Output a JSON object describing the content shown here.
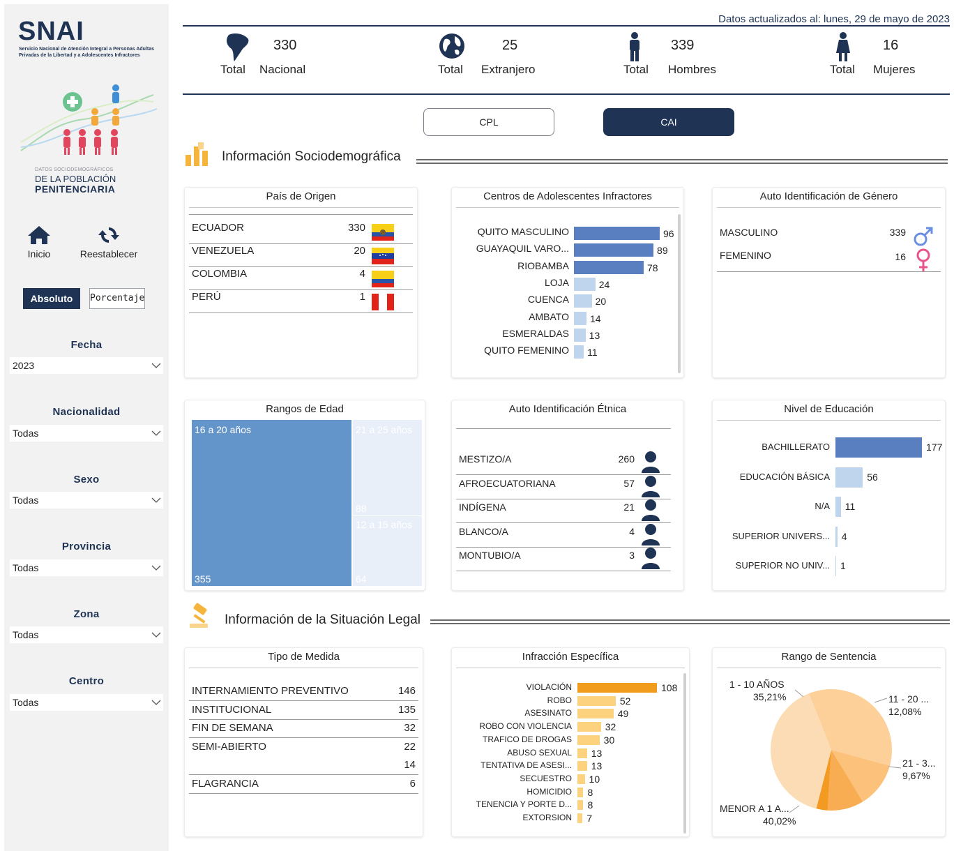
{
  "header": {
    "updated": "Datos actualizados al: lunes, 29 de mayo de 2023"
  },
  "sidebar": {
    "logo": "SNAI",
    "logo_subtitle": "Servicio Nacional de Atención Integral a Personas Adultas Privadas de la Libertad y a Adolescentes Infractores",
    "caption_small": "DATOS SOCIODEMOGRÁFICOS",
    "caption_mid": "DE LA POBLACIÓN",
    "caption_big": "PENITENCIARIA",
    "inicio": "Inicio",
    "reset": "Reestablecer",
    "absoluto": "Absoluto",
    "porcentaje": "Porcentaje",
    "filters": [
      {
        "title": "Fecha",
        "value": "2023"
      },
      {
        "title": "Nacionalidad",
        "value": "Todas"
      },
      {
        "title": "Sexo",
        "value": "Todas"
      },
      {
        "title": "Provincia",
        "value": "Todas"
      },
      {
        "title": "Zona",
        "value": "Todas"
      },
      {
        "title": "Centro",
        "value": "Todas"
      }
    ]
  },
  "kpis": [
    {
      "value": "330",
      "label1": "Total",
      "label2": "Nacional",
      "icon": "south-america-icon"
    },
    {
      "value": "25",
      "label1": "Total",
      "label2": "Extranjero",
      "icon": "globe-icon"
    },
    {
      "value": "339",
      "label1": "Total",
      "label2": "Hombres",
      "icon": "male-icon"
    },
    {
      "value": "16",
      "label1": "Total",
      "label2": "Mujeres",
      "icon": "female-icon"
    }
  ],
  "tabs": {
    "cpl": "CPL",
    "cai": "CAI"
  },
  "sections": {
    "socio": "Información Sociodemográfica",
    "legal": "Información de la Situación Legal"
  },
  "pais": {
    "title": "País de Origen",
    "rows": [
      {
        "name": "ECUADOR",
        "value": "330",
        "flag": "ecuador"
      },
      {
        "name": "VENEZUELA",
        "value": "20",
        "flag": "venezuela"
      },
      {
        "name": "COLOMBIA",
        "value": "4",
        "flag": "colombia"
      },
      {
        "name": "PERÚ",
        "value": "1",
        "flag": "peru"
      }
    ]
  },
  "centros": {
    "title": "Centros de Adolescentes Infractores",
    "rows": [
      {
        "name": "QUITO MASCULINO",
        "value": 96
      },
      {
        "name": "GUAYAQUIL VARO...",
        "value": 89
      },
      {
        "name": "RIOBAMBA",
        "value": 78
      },
      {
        "name": "LOJA",
        "value": 24
      },
      {
        "name": "CUENCA",
        "value": 20
      },
      {
        "name": "AMBATO",
        "value": 14
      },
      {
        "name": "ESMERALDAS",
        "value": 13
      },
      {
        "name": "QUITO FEMENINO",
        "value": 11
      }
    ]
  },
  "genero": {
    "title": "Auto Identificación de Género",
    "rows": [
      {
        "name": "MASCULINO",
        "value": "339"
      },
      {
        "name": "FEMENINO",
        "value": "16"
      }
    ]
  },
  "edad": {
    "title": "Rangos de Edad",
    "blocks": [
      {
        "label": "16 a 20 años",
        "value": "355"
      },
      {
        "label": "21 a 25 años",
        "value": "88"
      },
      {
        "label": "12 a 15 años",
        "value": "64"
      }
    ]
  },
  "etnia": {
    "title": "Auto Identificación Étnica",
    "rows": [
      {
        "name": "MESTIZO/A",
        "value": "260"
      },
      {
        "name": "AFROECUATORIANA",
        "value": "57"
      },
      {
        "name": "INDÍGENA",
        "value": "21"
      },
      {
        "name": "BLANCO/A",
        "value": "4"
      },
      {
        "name": "MONTUBIO/A",
        "value": "3"
      }
    ]
  },
  "educacion": {
    "title": "Nivel de Educación",
    "rows": [
      {
        "name": "BACHILLERATO",
        "value": 177
      },
      {
        "name": "EDUCACIÓN BÁSICA",
        "value": 56
      },
      {
        "name": "N/A",
        "value": 11
      },
      {
        "name": "SUPERIOR UNIVERS...",
        "value": 4
      },
      {
        "name": "SUPERIOR NO UNIV...",
        "value": 1
      }
    ]
  },
  "medida": {
    "title": "Tipo de Medida",
    "rows": [
      {
        "name": "INTERNAMIENTO PREVENTIVO",
        "value": "146"
      },
      {
        "name": "INSTITUCIONAL",
        "value": "135"
      },
      {
        "name": "FIN DE SEMANA",
        "value": "32"
      },
      {
        "name": "SEMI-ABIERTO",
        "value": "22"
      },
      {
        "name": "",
        "value": "14"
      },
      {
        "name": "FLAGRANCIA",
        "value": "6"
      }
    ]
  },
  "infraccion": {
    "title": "Infracción Específica",
    "rows": [
      {
        "name": "VIOLACIÓN",
        "value": 108
      },
      {
        "name": "ROBO",
        "value": 52
      },
      {
        "name": "ASESINATO",
        "value": 49
      },
      {
        "name": "ROBO CON VIOLENCIA",
        "value": 32
      },
      {
        "name": "TRAFICO DE DROGAS",
        "value": 30
      },
      {
        "name": "ABUSO SEXUAL",
        "value": 13
      },
      {
        "name": "TENTATIVA DE ASESI...",
        "value": 13
      },
      {
        "name": "SECUESTRO",
        "value": 10
      },
      {
        "name": "HOMICIDIO",
        "value": 8
      },
      {
        "name": "TENENCIA Y PORTE D...",
        "value": 8
      },
      {
        "name": "EXTORSION",
        "value": 7
      }
    ]
  },
  "sentencia": {
    "title": "Rango de Sentencia",
    "slices": [
      {
        "name": "MENOR A 1 A...",
        "pct": "40,02%",
        "value": 40.02,
        "color": "#fcdcb4"
      },
      {
        "name": "1 - 10 AÑOS",
        "pct": "35,21%",
        "value": 35.21,
        "color": "#fdd09a"
      },
      {
        "name": "11 - 20 ...",
        "pct": "12,08%",
        "value": 12.08,
        "color": "#fcc27b"
      },
      {
        "name": "21 - 3...",
        "pct": "9,67%",
        "value": 9.67,
        "color": "#f9ad52"
      },
      {
        "name": "",
        "pct": "",
        "value": 3.02,
        "color": "#f39a23"
      }
    ]
  },
  "colors": {
    "navy": "#1f3354",
    "bar_dark": "#5a7fc1",
    "bar_light": "#bfd5ee",
    "orange_dark": "#f29c1e",
    "orange_light": "#fcd27e"
  }
}
